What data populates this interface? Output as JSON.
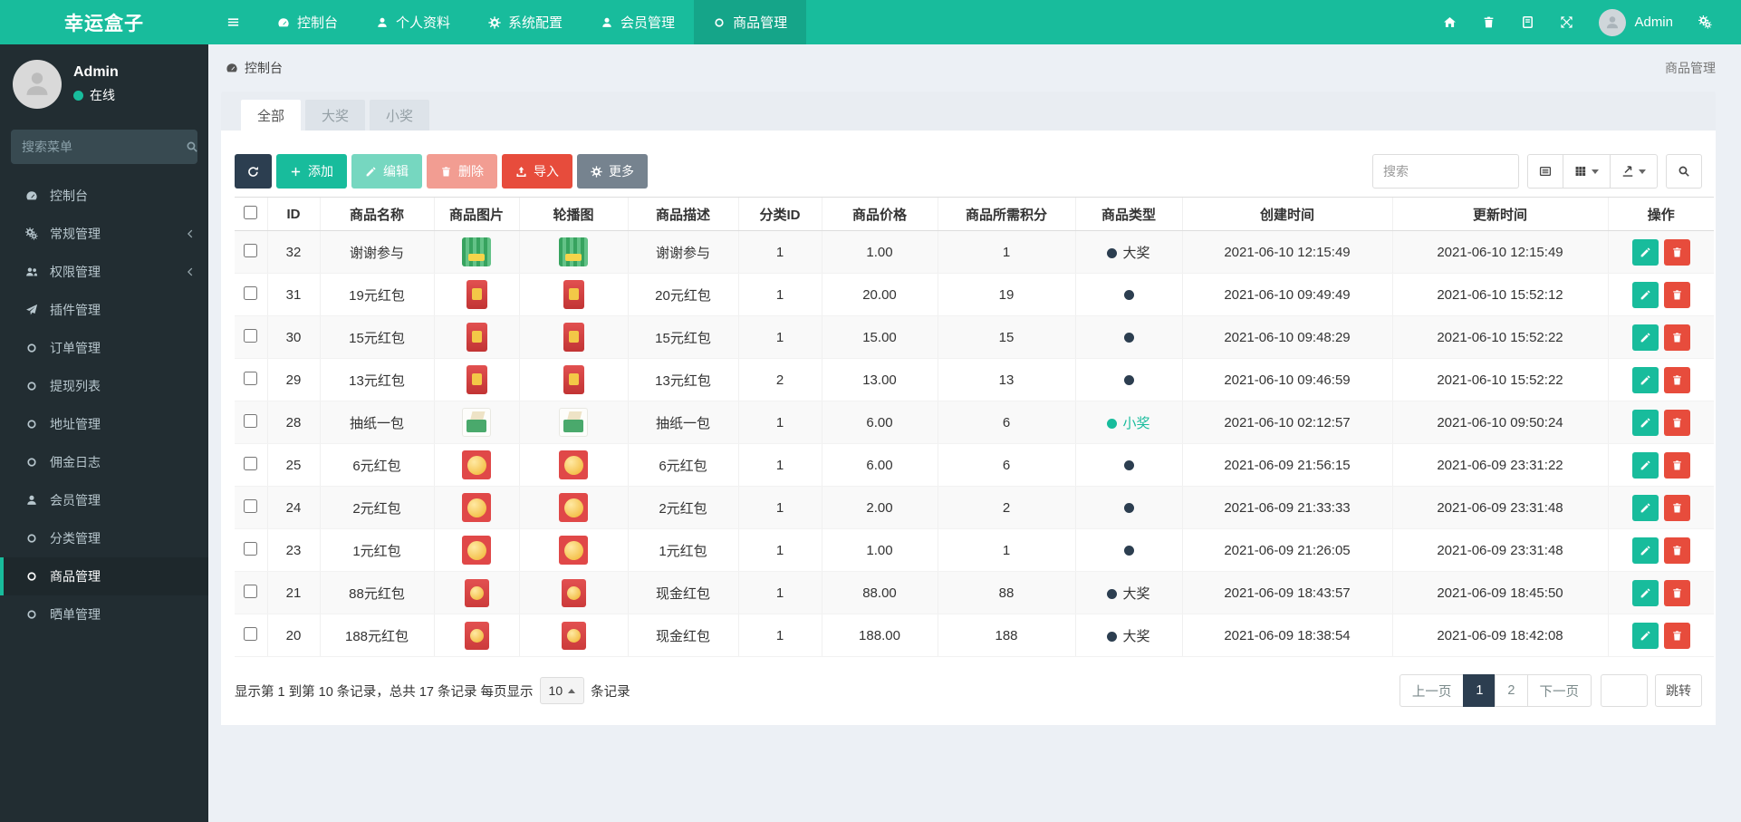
{
  "brand": "幸运盒子",
  "colors": {
    "primary": "#18bc9c",
    "dark": "#2c3e50",
    "danger": "#e74c3c"
  },
  "navbar": {
    "items": [
      {
        "key": "dashboard",
        "icon": "gauge",
        "label": "控制台"
      },
      {
        "key": "profile",
        "icon": "user",
        "label": "个人资料"
      },
      {
        "key": "system-config",
        "icon": "gear",
        "label": "系统配置"
      },
      {
        "key": "member-admin",
        "icon": "user",
        "label": "会员管理"
      },
      {
        "key": "goods-admin",
        "icon": "circle",
        "label": "商品管理",
        "active": true
      }
    ],
    "right_icons": [
      {
        "key": "home",
        "icon": "home"
      },
      {
        "key": "trash",
        "icon": "trash"
      },
      {
        "key": "language",
        "icon": "book"
      },
      {
        "key": "fullscreen",
        "icon": "expand"
      }
    ],
    "user": "Admin"
  },
  "sidebar": {
    "user": {
      "name": "Admin",
      "status": "在线"
    },
    "search_placeholder": "搜索菜单",
    "items": [
      {
        "key": "dashboard",
        "icon": "gauge",
        "label": "控制台"
      },
      {
        "key": "general-admin",
        "icon": "cogs",
        "label": "常规管理",
        "chevron": true
      },
      {
        "key": "auth-admin",
        "icon": "users",
        "label": "权限管理",
        "chevron": true
      },
      {
        "key": "addon-admin",
        "icon": "plane",
        "label": "插件管理"
      },
      {
        "key": "order-admin",
        "icon": "circle",
        "label": "订单管理"
      },
      {
        "key": "withdraw-list",
        "icon": "circle",
        "label": "提现列表"
      },
      {
        "key": "address-admin",
        "icon": "circle",
        "label": "地址管理"
      },
      {
        "key": "commission-log",
        "icon": "circle",
        "label": "佣金日志"
      },
      {
        "key": "member-admin",
        "icon": "user",
        "label": "会员管理"
      },
      {
        "key": "category-admin",
        "icon": "circle",
        "label": "分类管理"
      },
      {
        "key": "goods-admin",
        "icon": "circle",
        "label": "商品管理",
        "active": true
      },
      {
        "key": "share-admin",
        "icon": "circle",
        "label": "晒单管理"
      }
    ]
  },
  "breadcrumb": {
    "left": "控制台",
    "right": "商品管理"
  },
  "tabs": [
    {
      "label": "全部",
      "active": true
    },
    {
      "label": "大奖"
    },
    {
      "label": "小奖"
    }
  ],
  "toolbar": {
    "add": "添加",
    "edit": "编辑",
    "delete": "删除",
    "import": "导入",
    "more": "更多",
    "search_placeholder": "搜索"
  },
  "table": {
    "columns": [
      "ID",
      "商品名称",
      "商品图片",
      "轮播图",
      "商品描述",
      "分类ID",
      "商品价格",
      "商品所需积分",
      "商品类型",
      "创建时间",
      "更新时间",
      "操作"
    ],
    "rows": [
      {
        "id": "32",
        "name": "谢谢参与",
        "img": "green-box",
        "desc": "谢谢参与",
        "cat": "1",
        "price": "1.00",
        "points": "1",
        "type": {
          "label": "大奖",
          "variant": "dark"
        },
        "created": "2021-06-10 12:15:49",
        "updated": "2021-06-10 12:15:49"
      },
      {
        "id": "31",
        "name": "19元红包",
        "img": "red-packet",
        "desc": "20元红包",
        "cat": "1",
        "price": "20.00",
        "points": "19",
        "type": {
          "label": "",
          "variant": "dark"
        },
        "created": "2021-06-10 09:49:49",
        "updated": "2021-06-10 15:52:12"
      },
      {
        "id": "30",
        "name": "15元红包",
        "img": "red-packet",
        "desc": "15元红包",
        "cat": "1",
        "price": "15.00",
        "points": "15",
        "type": {
          "label": "",
          "variant": "dark"
        },
        "created": "2021-06-10 09:48:29",
        "updated": "2021-06-10 15:52:22"
      },
      {
        "id": "29",
        "name": "13元红包",
        "img": "red-packet",
        "desc": "13元红包",
        "cat": "2",
        "price": "13.00",
        "points": "13",
        "type": {
          "label": "",
          "variant": "dark"
        },
        "created": "2021-06-10 09:46:59",
        "updated": "2021-06-10 15:52:22"
      },
      {
        "id": "28",
        "name": "抽纸一包",
        "img": "tissue",
        "desc": "抽纸一包",
        "cat": "1",
        "price": "6.00",
        "points": "6",
        "type": {
          "label": "小奖",
          "variant": "green"
        },
        "created": "2021-06-10 02:12:57",
        "updated": "2021-06-10 09:50:24"
      },
      {
        "id": "25",
        "name": "6元红包",
        "img": "gold-red",
        "desc": "6元红包",
        "cat": "1",
        "price": "6.00",
        "points": "6",
        "type": {
          "label": "",
          "variant": "dark"
        },
        "created": "2021-06-09 21:56:15",
        "updated": "2021-06-09 23:31:22"
      },
      {
        "id": "24",
        "name": "2元红包",
        "img": "gold-red",
        "desc": "2元红包",
        "cat": "1",
        "price": "2.00",
        "points": "2",
        "type": {
          "label": "",
          "variant": "dark"
        },
        "created": "2021-06-09 21:33:33",
        "updated": "2021-06-09 23:31:48"
      },
      {
        "id": "23",
        "name": "1元红包",
        "img": "gold-red",
        "desc": "1元红包",
        "cat": "1",
        "price": "1.00",
        "points": "1",
        "type": {
          "label": "",
          "variant": "dark"
        },
        "created": "2021-06-09 21:26:05",
        "updated": "2021-06-09 23:31:48"
      },
      {
        "id": "21",
        "name": "88元红包",
        "img": "red-coin",
        "desc": "现金红包",
        "cat": "1",
        "price": "88.00",
        "points": "88",
        "type": {
          "label": "大奖",
          "variant": "dark"
        },
        "created": "2021-06-09 18:43:57",
        "updated": "2021-06-09 18:45:50"
      },
      {
        "id": "20",
        "name": "188元红包",
        "img": "red-coin",
        "desc": "现金红包",
        "cat": "1",
        "price": "188.00",
        "points": "188",
        "type": {
          "label": "大奖",
          "variant": "dark"
        },
        "created": "2021-06-09 18:38:54",
        "updated": "2021-06-09 18:42:08"
      }
    ]
  },
  "pagination": {
    "summary_prefix": "显示第 1 到第 10 条记录，总共 17 条记录 每页显示",
    "page_size": "10",
    "summary_suffix": "条记录",
    "prev": "上一页",
    "pages": [
      "1",
      "2"
    ],
    "active_page": "1",
    "next": "下一页",
    "jump": "跳转"
  }
}
